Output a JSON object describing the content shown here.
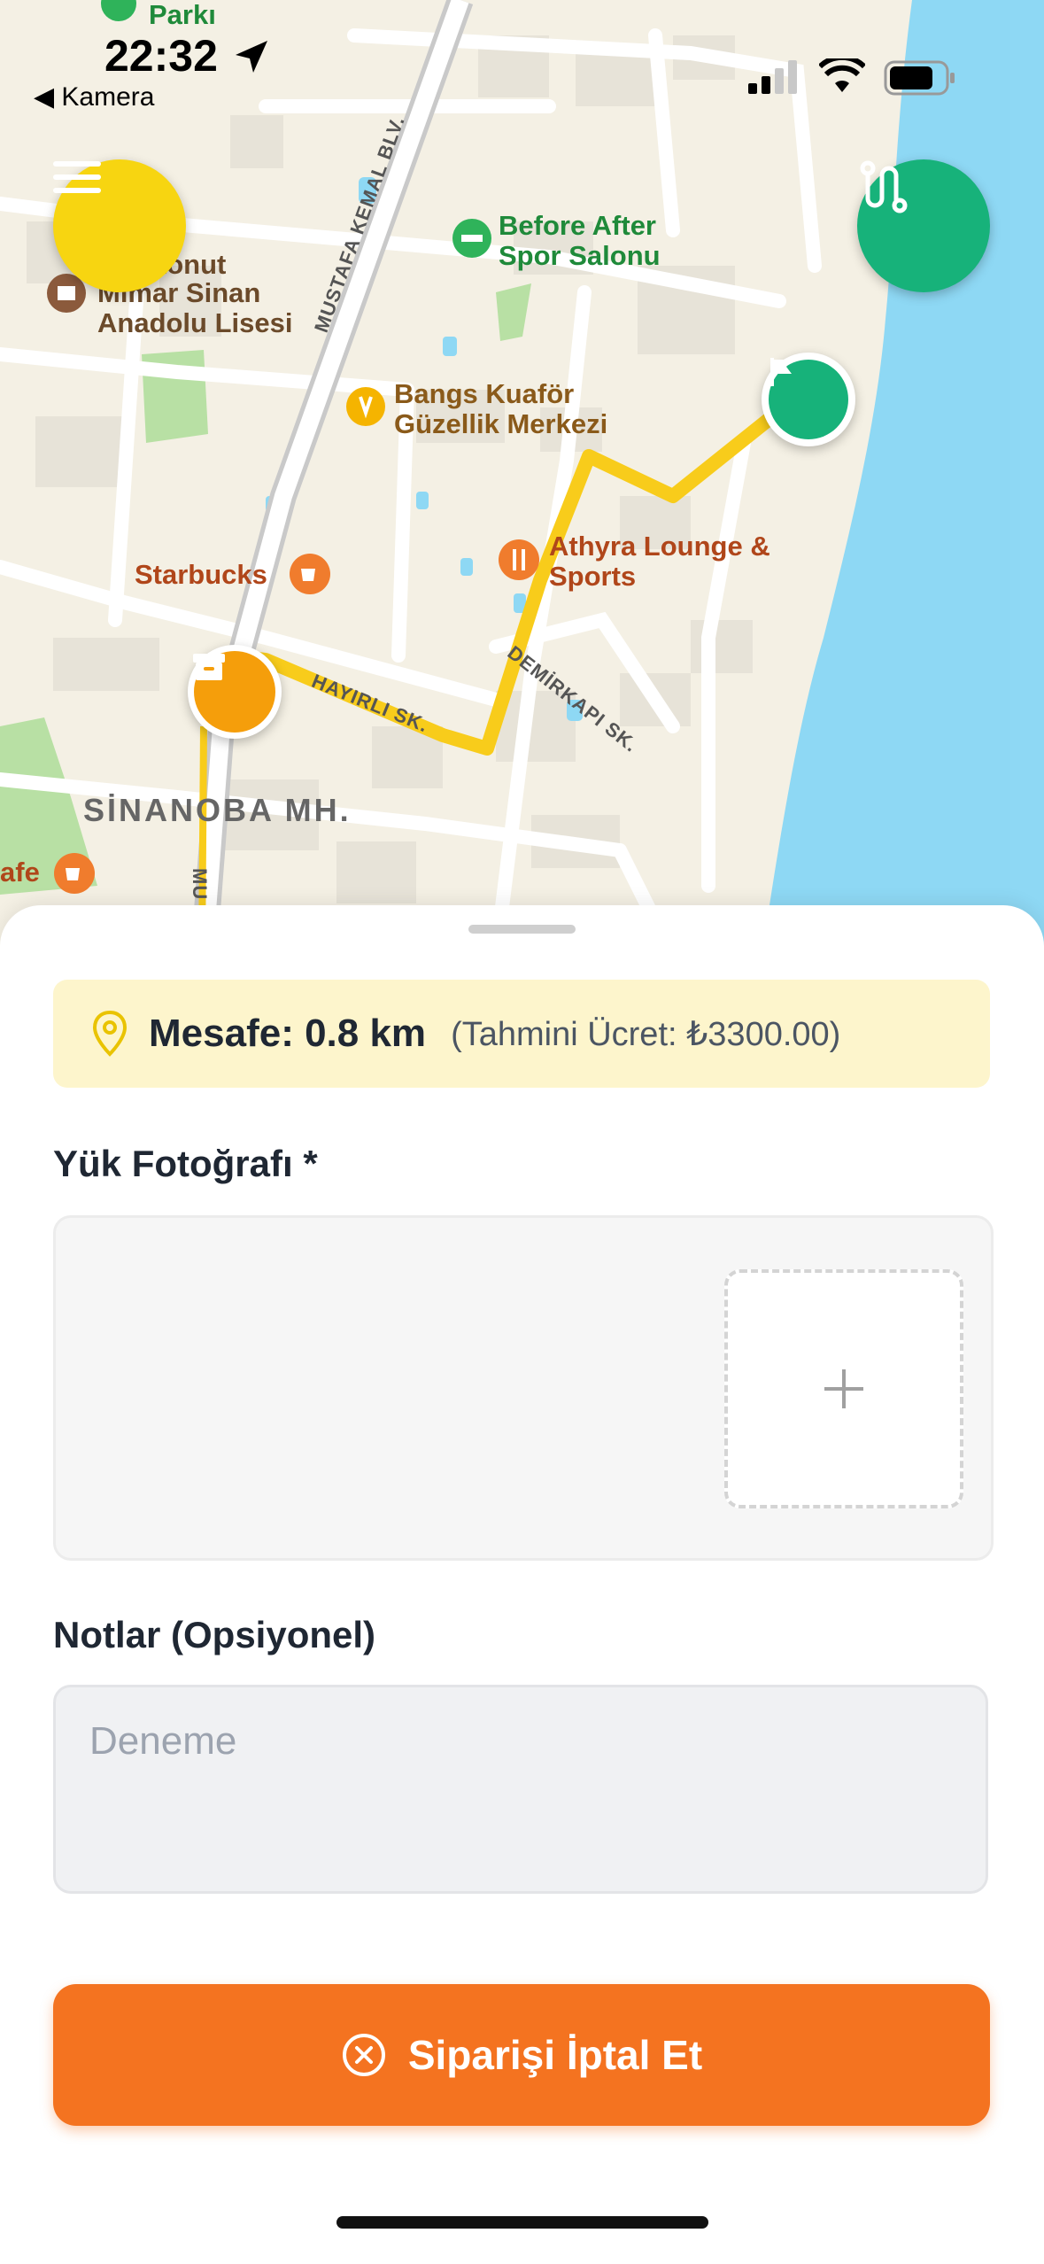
{
  "status": {
    "time": "22:32",
    "back_label": "Kamera"
  },
  "map": {
    "labels": {
      "park": "Parkı",
      "school_l1": "k Konut",
      "school_l2": "Mimar Sinan",
      "school_l3": "Anadolu Lisesi",
      "gym_l1": "Before After",
      "gym_l2": "Spor Salonu",
      "salon_l1": "Bangs Kuaför",
      "salon_l2": "Güzellik Merkezi",
      "starbucks": "Starbucks",
      "lounge_l1": "Athyra Lounge &",
      "lounge_l2": "Sports",
      "blvd": "MUSTAFA KEMAL BLV.",
      "street1": "HAYIRLI SK.",
      "street2": "DEMİRKAPI SK.",
      "street3": "MU",
      "district": "SİNANOBA MH.",
      "cafe": "afe"
    },
    "icons": [
      "menu-icon",
      "route-icon",
      "flag-icon",
      "box-icon"
    ],
    "colors": {
      "route": "#f8cc1b",
      "menu_button": "#f7d511",
      "route_button": "#17b27a",
      "origin": "#f59e0b",
      "sea": "#8ed8f4"
    }
  },
  "sheet": {
    "distance_label": "Mesafe: 0.8 km",
    "fee_label": "(Tahmini Ücret: ₺3300.00)",
    "photo_label": "Yük Fotoğrafı *",
    "notes_label": "Notlar (Opsiyonel)",
    "notes_value": "Deneme",
    "cancel_label": "Siparişi İptal Et",
    "colors": {
      "accent": "#f47320",
      "distance_bg": "#fdf5cc"
    }
  }
}
